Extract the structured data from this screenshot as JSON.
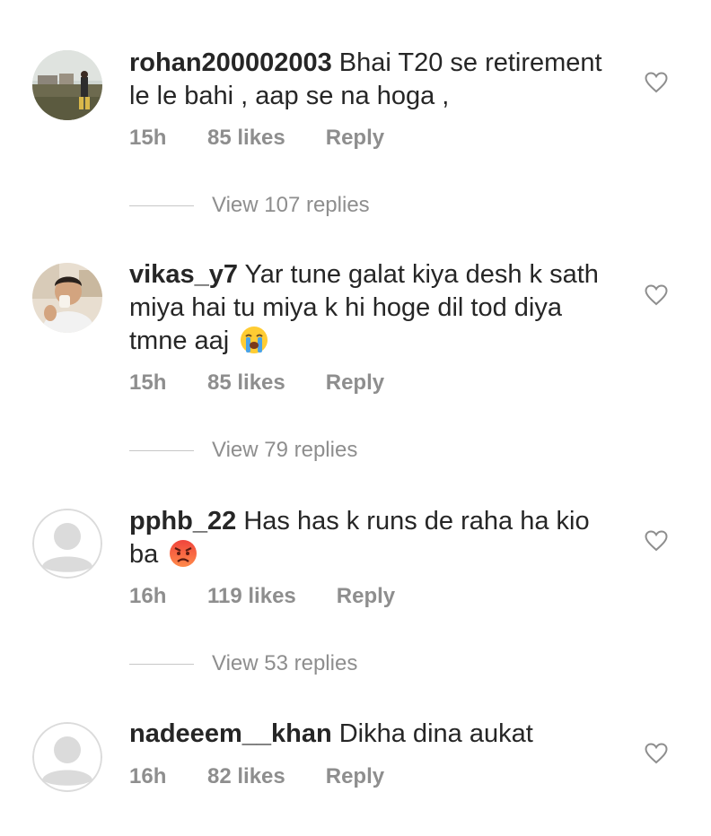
{
  "comments": [
    {
      "username": "rohan200002003",
      "text": "Bhai T20 se retirement le le bahi , aap se na hoga ,",
      "time": "15h",
      "likes": "85 likes",
      "reply": "Reply",
      "view_replies": "View 107 replies",
      "avatar": "photo-landscape"
    },
    {
      "username": "vikas_y7",
      "text": "Yar tune galat kiya desh k sath miya hai tu miya k hi hoge dil tod diya tmne aaj",
      "emoji": "loudly-crying-face-icon",
      "time": "15h",
      "likes": "85 likes",
      "reply": "Reply",
      "view_replies": "View 79 replies",
      "avatar": "photo-person"
    },
    {
      "username": "pphb_22",
      "text": "Has has k runs de raha ha kio ba",
      "emoji": "angry-face-icon",
      "time": "16h",
      "likes": "119 likes",
      "reply": "Reply",
      "view_replies": "View 53 replies",
      "avatar": "default-avatar"
    },
    {
      "username": "nadeeem__khan",
      "text": "Dikha dina aukat",
      "time": "16h",
      "likes": "82 likes",
      "reply": "Reply",
      "avatar": "default-avatar"
    }
  ],
  "colors": {
    "text": "#262626",
    "secondary": "#8e8e8e",
    "divider": "#c7c7c7",
    "avatar_placeholder": "#dbdbdb"
  }
}
